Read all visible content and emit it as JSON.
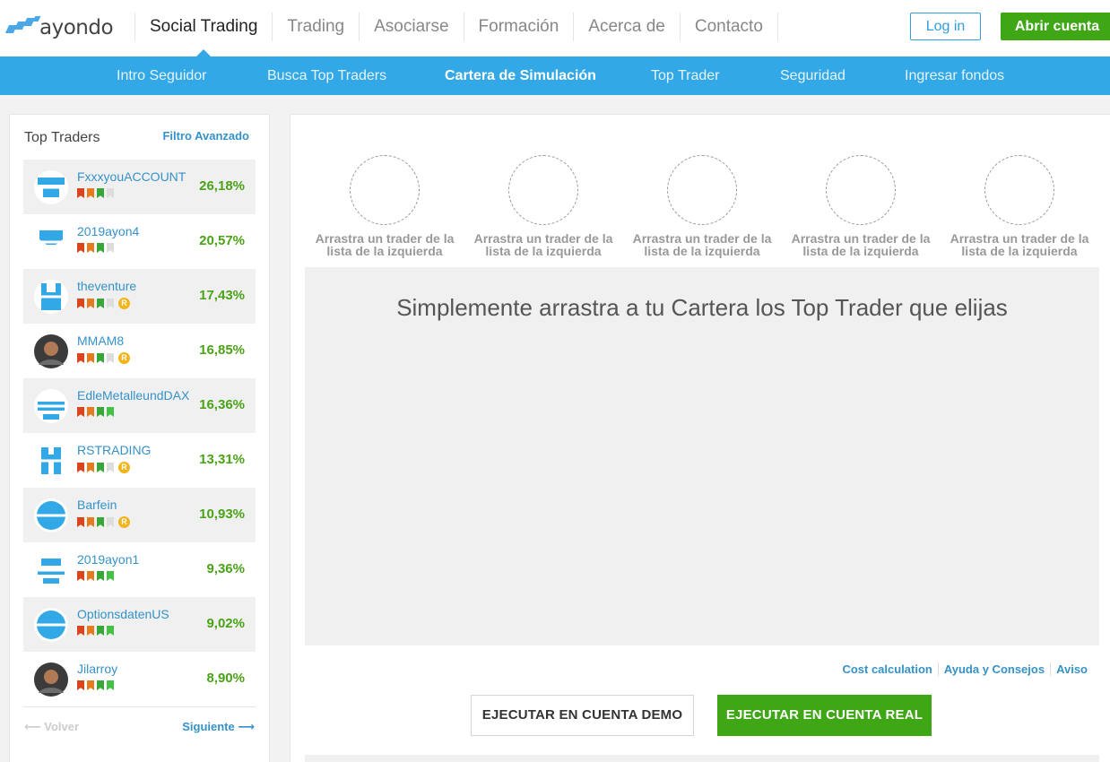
{
  "header": {
    "logo_text": "ayondo",
    "nav": [
      "Social Trading",
      "Trading",
      "Asociarse",
      "Formación",
      "Acerca de",
      "Contacto"
    ],
    "nav_active": 0,
    "login_label": "Log in",
    "open_account_label": "Abrir cuenta",
    "accent_color": "#33a8e6",
    "cta_color": "#3fa716"
  },
  "subnav": {
    "items": [
      "Intro Seguidor",
      "Busca Top Traders",
      "Cartera de Simulación",
      "Top Trader",
      "Seguridad",
      "Ingresar fondos"
    ],
    "active": 2
  },
  "sidebar": {
    "title": "Top Traders",
    "filter_label": "Filtro Avanzado",
    "traders": [
      {
        "name": "FxxxyouACCOUNT",
        "return": "26,18%",
        "levels": 3,
        "r_badge": false,
        "avatar": "pattern-icon"
      },
      {
        "name": "2019ayon4",
        "return": "20,57%",
        "levels": 3,
        "r_badge": false,
        "avatar": "pattern-icon"
      },
      {
        "name": "theventure",
        "return": "17,43%",
        "levels": 3,
        "r_badge": true,
        "avatar": "pattern-icon"
      },
      {
        "name": "MMAM8",
        "return": "16,85%",
        "levels": 3,
        "r_badge": true,
        "avatar": "photo"
      },
      {
        "name": "EdleMetalleundDAX",
        "return": "16,36%",
        "levels": 4,
        "r_badge": false,
        "avatar": "pattern-icon"
      },
      {
        "name": "RSTRADING",
        "return": "13,31%",
        "levels": 3,
        "r_badge": true,
        "avatar": "pattern-icon"
      },
      {
        "name": "Barfein",
        "return": "10,93%",
        "levels": 3,
        "r_badge": true,
        "avatar": "pattern-icon"
      },
      {
        "name": "2019ayon1",
        "return": "9,36%",
        "levels": 4,
        "r_badge": false,
        "avatar": "pattern-icon"
      },
      {
        "name": "OptionsdatenUS",
        "return": "9,02%",
        "levels": 4,
        "r_badge": false,
        "avatar": "pattern-icon"
      },
      {
        "name": "Jilarroy",
        "return": "8,90%",
        "levels": 4,
        "r_badge": false,
        "avatar": "photo"
      }
    ],
    "r_badge_label": "R",
    "prev_label": "⟵ Volver",
    "next_label": "Siguiente ⟶"
  },
  "portfolio": {
    "slot_caption": "Arrastra un trader de la lista de la izquierda",
    "slot_count": 5,
    "drop_text": "Simplemente arrastra a tu Cartera los Top Trader que elijas",
    "links": [
      "Cost calculation",
      "Ayuda y Consejos",
      "Aviso"
    ],
    "demo_button": "EJECUTAR EN CUENTA DEMO",
    "real_button": "EJECUTAR EN CUENTA REAL"
  }
}
